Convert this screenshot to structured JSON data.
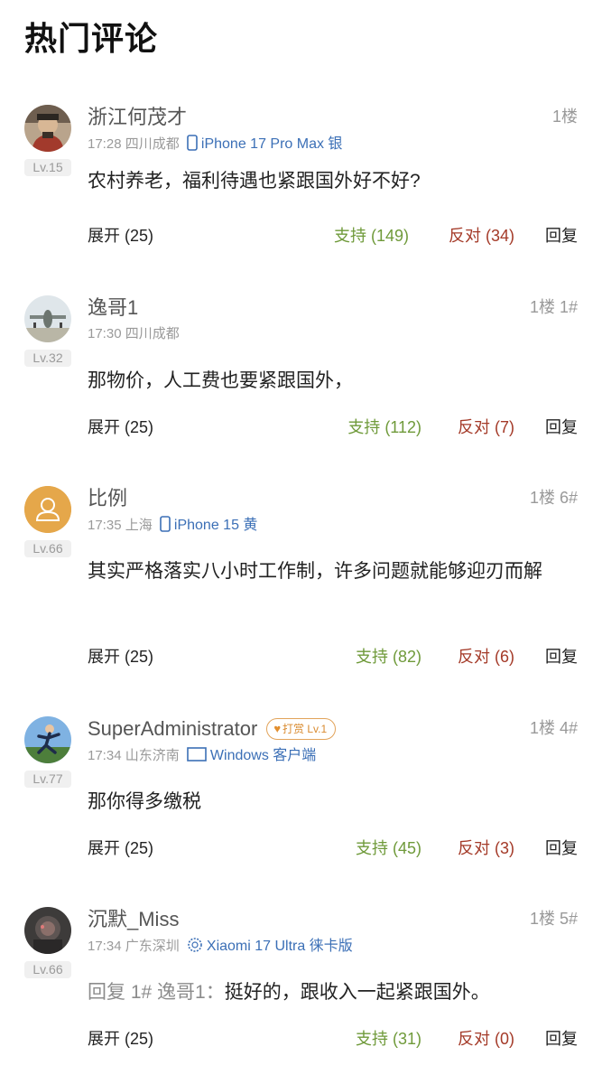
{
  "page_title": "热门评论",
  "colors": {
    "support": "#6f9a3a",
    "oppose": "#a43a28",
    "device_link": "#3b6fb6",
    "tip_badge": "#e2a35a"
  },
  "comments": [
    {
      "username": "浙江何茂才",
      "level": "Lv.15",
      "floor": "1楼",
      "time": "17:28",
      "location": "四川成都",
      "device": "iPhone 17 Pro Max 银",
      "device_icon": "phone-icon",
      "text": "农村养老，福利待遇也紧跟国外好不好?",
      "expand": "展开 (25)",
      "support": "支持 (149)",
      "oppose": "反对 (34)",
      "reply": "回复"
    },
    {
      "username": "逸哥1",
      "level": "Lv.32",
      "floor": "1楼 1#",
      "time": "17:30",
      "location": "四川成都",
      "text": "那物价，人工费也要紧跟国外，",
      "expand": "展开 (25)",
      "support": "支持 (112)",
      "oppose": "反对 (7)",
      "reply": "回复"
    },
    {
      "username": "比例",
      "level": "Lv.66",
      "floor": "1楼 6#",
      "time": "17:35",
      "location": "上海",
      "device": "iPhone 15 黄",
      "device_icon": "phone-icon",
      "text": "其实严格落实八小时工作制，许多问题就能够迎刃而解",
      "expand": "展开 (25)",
      "support": "支持 (82)",
      "oppose": "反对 (6)",
      "reply": "回复"
    },
    {
      "username": "SuperAdministrator",
      "tip_badge": "打赏 Lv.1",
      "level": "Lv.77",
      "floor": "1楼 4#",
      "time": "17:34",
      "location": "山东济南",
      "device": "Windows 客户端",
      "device_icon": "monitor-icon",
      "text": "那你得多缴税",
      "expand": "展开 (25)",
      "support": "支持 (45)",
      "oppose": "反对 (3)",
      "reply": "回复"
    },
    {
      "username": "沉默_Miss",
      "level": "Lv.66",
      "floor": "1楼 5#",
      "time": "17:34",
      "location": "广东深圳",
      "device": "Xiaomi 17 Ultra 徕卡版",
      "device_icon": "xiaomi-icon",
      "reply_prefix": "回复 1# 逸哥1：",
      "text": "挺好的，跟收入一起紧跟国外。",
      "expand": "展开 (25)",
      "support": "支持 (31)",
      "oppose": "反对 (0)",
      "reply": "回复"
    }
  ]
}
